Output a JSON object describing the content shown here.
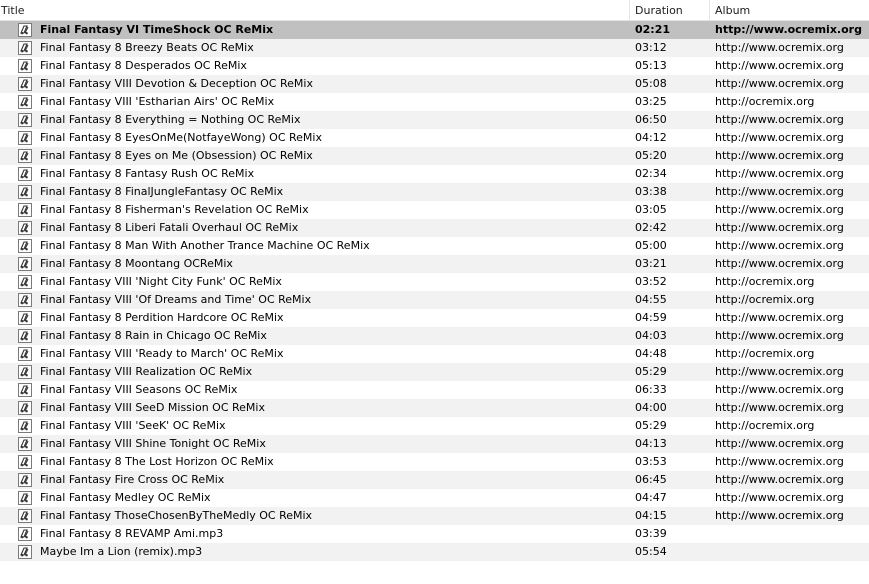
{
  "columns": {
    "title": "Title",
    "duration": "Duration",
    "album": "Album"
  },
  "colors": {
    "selected_row": "#c0c0c0",
    "alt_row": "#f2f2f2"
  },
  "row_icon": "audio-file-icon",
  "tracks": [
    {
      "title": "Final Fantasy VI TimeShock OC ReMix",
      "duration": "02:21",
      "album": "http://www.ocremix.org",
      "selected": true
    },
    {
      "title": "Final Fantasy 8 Breezy Beats OC ReMix",
      "duration": "03:12",
      "album": "http://www.ocremix.org"
    },
    {
      "title": "Final Fantasy 8 Desperados OC ReMix",
      "duration": "05:13",
      "album": "http://www.ocremix.org"
    },
    {
      "title": "Final Fantasy VIII Devotion & Deception OC ReMix",
      "duration": "05:08",
      "album": "http://www.ocremix.org"
    },
    {
      "title": "Final Fantasy VIII 'Estharian Airs' OC ReMix",
      "duration": "03:25",
      "album": "http://ocremix.org"
    },
    {
      "title": "Final Fantasy 8 Everything = Nothing OC ReMix",
      "duration": "06:50",
      "album": "http://www.ocremix.org"
    },
    {
      "title": "Final Fantasy 8 EyesOnMe(NotfayeWong) OC ReMix",
      "duration": "04:12",
      "album": "http://www.ocremix.org"
    },
    {
      "title": "Final Fantasy 8 Eyes on Me (Obsession) OC ReMix",
      "duration": "05:20",
      "album": "http://www.ocremix.org"
    },
    {
      "title": "Final Fantasy 8 Fantasy Rush OC ReMix",
      "duration": "02:34",
      "album": "http://www.ocremix.org"
    },
    {
      "title": "Final Fantasy 8 FinalJungleFantasy OC ReMix",
      "duration": "03:38",
      "album": "http://www.ocremix.org"
    },
    {
      "title": "Final Fantasy 8 Fisherman's Revelation OC ReMix",
      "duration": "03:05",
      "album": "http://www.ocremix.org"
    },
    {
      "title": "Final Fantasy 8 Liberi Fatali Overhaul OC ReMix",
      "duration": "02:42",
      "album": "http://www.ocremix.org"
    },
    {
      "title": "Final Fantasy 8 Man With Another Trance Machine OC ReMix",
      "duration": "05:00",
      "album": "http://www.ocremix.org"
    },
    {
      "title": "Final Fantasy 8 Moontang OCReMix",
      "duration": "03:21",
      "album": "http://www.ocremix.org"
    },
    {
      "title": "Final Fantasy VIII 'Night City Funk' OC ReMix",
      "duration": "03:52",
      "album": "http://ocremix.org"
    },
    {
      "title": "Final Fantasy VIII 'Of Dreams and Time' OC ReMix",
      "duration": "04:55",
      "album": "http://ocremix.org"
    },
    {
      "title": "Final Fantasy 8 Perdition Hardcore OC ReMix",
      "duration": "04:59",
      "album": "http://www.ocremix.org"
    },
    {
      "title": "Final Fantasy 8 Rain in Chicago OC ReMix",
      "duration": "04:03",
      "album": "http://www.ocremix.org"
    },
    {
      "title": "Final Fantasy VIII 'Ready to March' OC ReMix",
      "duration": "04:48",
      "album": "http://ocremix.org"
    },
    {
      "title": "Final Fantasy VIII Realization OC ReMix",
      "duration": "05:29",
      "album": "http://www.ocremix.org"
    },
    {
      "title": "Final Fantasy VIII Seasons OC ReMix",
      "duration": "06:33",
      "album": "http://www.ocremix.org"
    },
    {
      "title": "Final Fantasy VIII SeeD Mission OC ReMix",
      "duration": "04:00",
      "album": "http://www.ocremix.org"
    },
    {
      "title": "Final Fantasy VIII 'SeeK' OC ReMix",
      "duration": "05:29",
      "album": "http://ocremix.org"
    },
    {
      "title": "Final Fantasy VIII Shine Tonight OC ReMix",
      "duration": "04:13",
      "album": "http://www.ocremix.org"
    },
    {
      "title": "Final Fantasy 8 The Lost Horizon OC ReMix",
      "duration": "03:53",
      "album": "http://www.ocremix.org"
    },
    {
      "title": "Final Fantasy Fire Cross OC ReMix",
      "duration": "06:45",
      "album": "http://www.ocremix.org"
    },
    {
      "title": "Final Fantasy Medley OC ReMix",
      "duration": "04:47",
      "album": "http://www.ocremix.org"
    },
    {
      "title": "Final Fantasy ThoseChosenByTheMedly OC ReMix",
      "duration": "04:15",
      "album": "http://www.ocremix.org"
    },
    {
      "title": "Final Fantasy 8 REVAMP Ami.mp3",
      "duration": "03:39",
      "album": ""
    },
    {
      "title": "Maybe Im a Lion (remix).mp3",
      "duration": "05:54",
      "album": ""
    }
  ]
}
